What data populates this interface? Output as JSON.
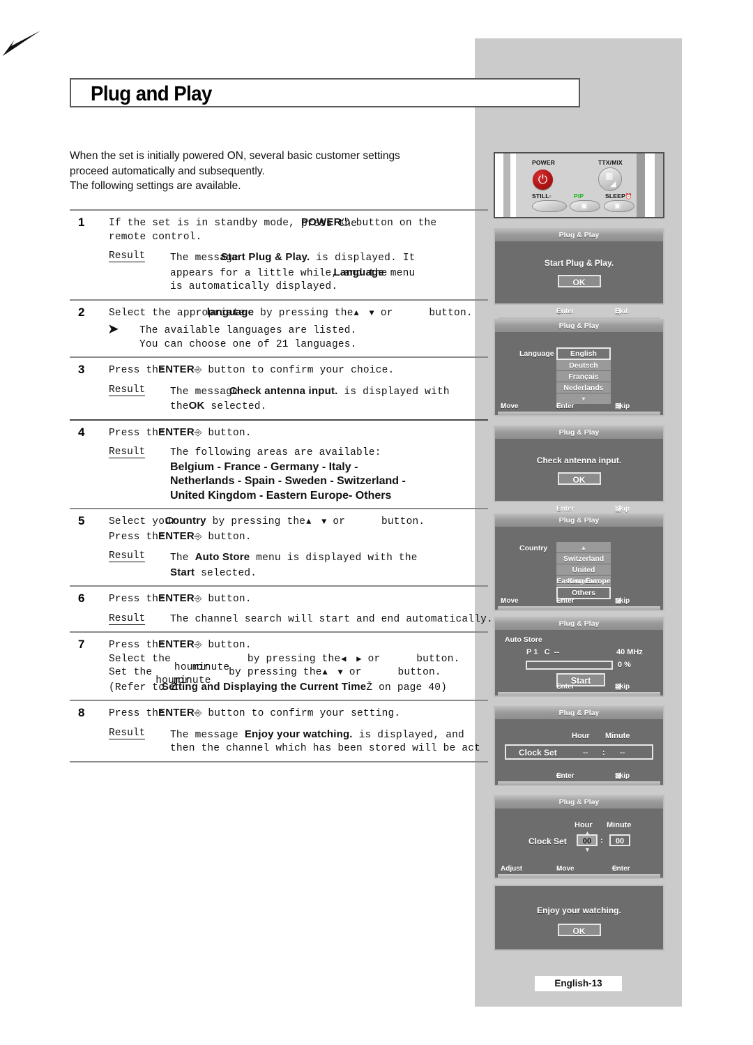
{
  "page": {
    "title": "Plug and Play",
    "footer": "English-13",
    "intro": [
      "When the set is initially powered ON, several basic customer settings",
      "proceed automatically and subsequently.",
      "The following settings are available."
    ]
  },
  "steps": [
    {
      "num": "1",
      "lines": [
        {
          "plain_a": "If the set is in standby mode, ",
          "plain_over": "press the",
          "bold": "POWER",
          "icon": "power-icon",
          "plain_b": " button on the"
        },
        {
          "plain_a": "remote control."
        }
      ],
      "result_label": "Result",
      "result_lines": [
        {
          "plain_a": "The message ",
          "bold": "Start Plug & Play.",
          "plain_b": " is displayed. It"
        },
        {
          "plain_a": "appears for a little while, and the ",
          "bold": "Language",
          "plain_b": " menu"
        },
        {
          "plain_a": "is automatically displayed."
        }
      ]
    },
    {
      "num": "2",
      "lines": [
        {
          "plain_a": "Select the appropriate ",
          "bold": "language",
          "plain_b": " by pressing the ",
          "icon": "up-down-arrows",
          "plain_c": " or ",
          "plain_d": " button."
        }
      ],
      "note_glyph": "arrow-bullet",
      "note_lines": [
        "The available languages are listed.",
        "You can choose one of 21 languages."
      ]
    },
    {
      "num": "3",
      "lines": [
        {
          "plain_a": "Press the ",
          "bold": "ENTER",
          "icon": "enter-icon",
          "plain_b": " button to confirm your choice."
        }
      ],
      "result_label": "Result",
      "result_lines": [
        {
          "plain_a": "The message ",
          "bold": "Check antenna input.",
          "plain_b": " is displayed with"
        },
        {
          "plain_a": "the ",
          "bold": "OK",
          "plain_b": " selected."
        }
      ]
    },
    {
      "num": "4",
      "lines": [
        {
          "plain_a": "Press the ",
          "bold": "ENTER",
          "icon": "enter-icon",
          "plain_b": " button."
        }
      ],
      "result_label": "Result",
      "result_lines": [
        {
          "plain_a": "The following areas are available:"
        }
      ],
      "areas": [
        "Belgium - France - Germany -  Italy -",
        "Netherlands - Spain - Sweden - Switzerland -",
        "United Kingdom - Eastern Europe- Others"
      ]
    },
    {
      "num": "5",
      "lines": [
        {
          "plain_a": "Select your ",
          "bold": "Country",
          "plain_b": " by pressing the ",
          "icon": "up-down-arrows",
          "plain_c": " or ",
          "plain_d": " button."
        },
        {
          "plain_a": "Press the ",
          "bold2": "ENTER",
          "icon2": "enter-icon",
          "plain_e": " button."
        }
      ],
      "result_label": "Result",
      "result_lines": [
        {
          "plain_a": "The ",
          "bold": "Auto Store",
          "plain_b": " menu is displayed with the"
        },
        {
          "bold": "Start",
          "plain_b": " selected."
        }
      ]
    },
    {
      "num": "6",
      "lines": [
        {
          "plain_a": "Press the ",
          "bold": "ENTER",
          "icon": "enter-icon",
          "plain_b": " button."
        }
      ],
      "result_label": "Result",
      "result_lines": [
        {
          "plain_a": "The channel search will start and end automatically."
        }
      ]
    },
    {
      "num": "7",
      "lines": [
        {
          "plain_a": "Press the ",
          "bold": "ENTER",
          "icon": "enter-icon",
          "plain_b": " button."
        },
        {
          "plain_a": "Select the ",
          "over": "hour",
          "over2": "or",
          "over3": "minute",
          "plain_b": " by pressing the ",
          "icon": "left-right-arrows",
          "plain_c": " or ",
          "plain_d": " button."
        },
        {
          "plain_a": "Set the ",
          "over": "hour",
          "over2": "or",
          "over3": "minute",
          "plain_b": " by pressing the ",
          "icon": "up-down-arrows",
          "plain_c": " or ",
          "plain_d": " button."
        },
        {
          "plain_a": "(Refer to Ž",
          "bold": "Setting and Displaying the Current Time",
          "plain_b": "Ž on page 40)"
        }
      ]
    },
    {
      "num": "8",
      "lines": [
        {
          "plain_a": "Press the ",
          "bold": "ENTER",
          "icon": "enter-icon",
          "plain_b": " button to confirm your setting."
        }
      ],
      "result_label": "Result",
      "result_lines": [
        {
          "plain_a": "The message ",
          "bold": "Enjoy your watching.",
          "plain_b": " is displayed, and"
        },
        {
          "plain_a": "then the channel which has been stored will be act"
        }
      ]
    }
  ],
  "remote": {
    "power_label": "POWER",
    "ttx_label": "TTX/MIX",
    "still_label": "STILL",
    "pip_label": "PIP",
    "sleep_label": "SLEEP",
    "pip_color": "#16b816"
  },
  "osd": {
    "title": "Plug & Play",
    "keys": {
      "enter": "Enter",
      "exit": "Exit",
      "skip": "Skip",
      "move": "Move",
      "adjust": "Adjust"
    },
    "panel1": {
      "message": "Start Plug & Play.",
      "ok": "OK"
    },
    "panel2": {
      "label": "Language",
      "options": [
        "English",
        "Deutsch",
        "Français",
        "Nederlands",
        "▼"
      ],
      "selected_index": 0
    },
    "panel3": {
      "message": "Check antenna input.",
      "ok": "OK"
    },
    "panel4": {
      "label": "Country",
      "options": [
        "▲",
        "Switzerland",
        "United Kingdom",
        "Eastern Europe",
        "Others"
      ],
      "selected_index": 4
    },
    "panel5": {
      "label": "Auto Store",
      "p_label": "P",
      "p_value": "1",
      "c_label": "C",
      "c_value": "--",
      "frequency": "40 MHz",
      "percent": "0  %",
      "start": "Start"
    },
    "panel6": {
      "hour_label": "Hour",
      "minute_label": "Minute",
      "clock_label": "Clock Set",
      "hour_value": "--",
      "separator": ":",
      "minute_value": "--"
    },
    "panel7": {
      "hour_label": "Hour",
      "minute_label": "Minute",
      "clock_label": "Clock Set",
      "hour_value": "00",
      "separator": ":",
      "minute_value": "00"
    },
    "panel8": {
      "message": "Enjoy your watching.",
      "ok": "OK"
    }
  }
}
